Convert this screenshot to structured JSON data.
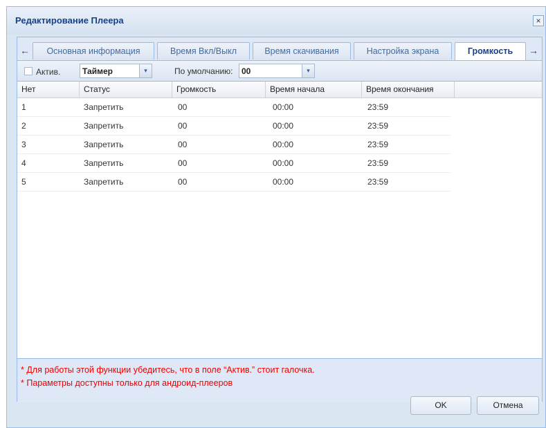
{
  "window": {
    "title": "Редактирование Плеера",
    "close_glyph": "×"
  },
  "tabs": {
    "scroll_left_glyph": "←",
    "scroll_right_glyph": "→",
    "items": [
      {
        "label": "Основная информация"
      },
      {
        "label": "Время Вкл/Выкл"
      },
      {
        "label": "Время скачивания"
      },
      {
        "label": "Настройка экрана"
      },
      {
        "label": "Громкость",
        "active": true
      }
    ]
  },
  "toolbar": {
    "active_label": "Актив.",
    "active_checked": false,
    "mode_value": "Таймер",
    "default_label": "По умолчанию:",
    "default_value": "00",
    "dropdown_glyph": "▾"
  },
  "grid": {
    "columns": [
      "Нет",
      "Статус",
      "Громкость",
      "Время начала",
      "Время окончания"
    ],
    "rows": [
      [
        "1",
        "Запретить",
        "00",
        "00:00",
        "23:59"
      ],
      [
        "2",
        "Запретить",
        "00",
        "00:00",
        "23:59"
      ],
      [
        "3",
        "Запретить",
        "00",
        "00:00",
        "23:59"
      ],
      [
        "4",
        "Запретить",
        "00",
        "00:00",
        "23:59"
      ],
      [
        "5",
        "Запретить",
        "00",
        "00:00",
        "23:59"
      ]
    ]
  },
  "notes": [
    "* Для работы этой функции убедитесь, что в поле “Актив.” стоит галочка.",
    "* Параметры доступны только для андроид-плееров"
  ],
  "buttons": {
    "ok": "OK",
    "cancel": "Отмена"
  }
}
